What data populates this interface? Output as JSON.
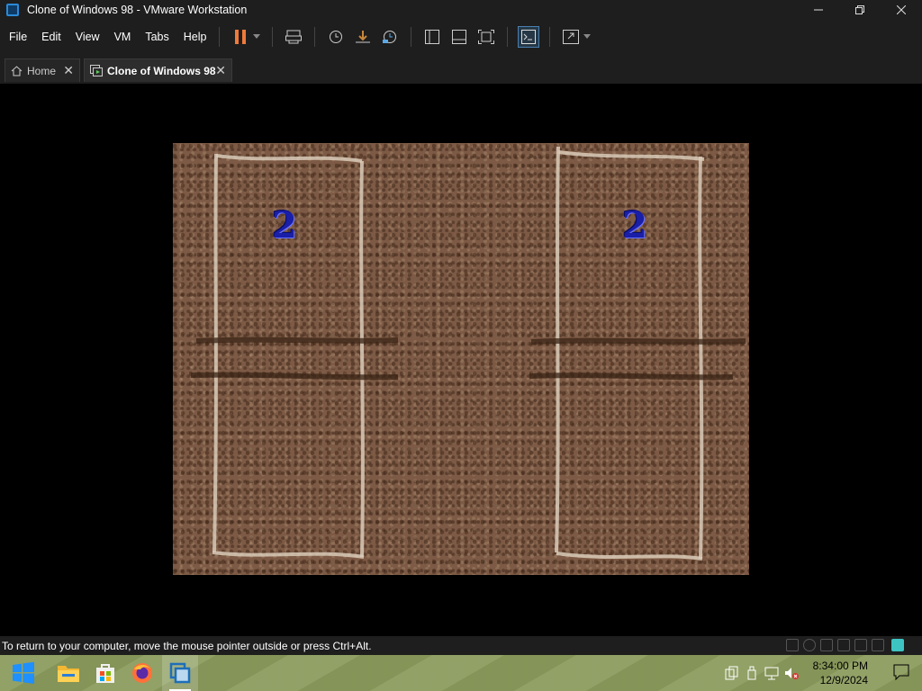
{
  "window": {
    "title": "Clone of Windows 98 - VMware Workstation",
    "controls": [
      "minimize",
      "restore",
      "close"
    ]
  },
  "menu": {
    "items": [
      "File",
      "Edit",
      "View",
      "VM",
      "Tabs",
      "Help"
    ]
  },
  "toolbar": {
    "buttons": [
      "pause-icon",
      "chevron-down-icon",
      "send-keys-icon",
      "snapshot-icon",
      "revert-snapshot-icon",
      "snapshot-manager-icon",
      "library-icon",
      "thumbnail-icon",
      "fullscreen-icon",
      "console-icon",
      "unity-icon",
      "chevron-down-icon"
    ],
    "pause_color": "#f07a3a"
  },
  "tabs": [
    {
      "label": "Home",
      "icon": "home-icon"
    },
    {
      "label": "Clone of Windows 98",
      "icon": "vm-icon",
      "active": true
    }
  ],
  "game": {
    "numbers": [
      "2",
      "2"
    ],
    "number_color": "#1a1fa8"
  },
  "status": {
    "message": "To return to your computer, move the mouse pointer outside or press Ctrl+Alt."
  },
  "taskbar": {
    "apps": [
      "windows-start-icon",
      "file-explorer-icon",
      "store-icon",
      "firefox-icon",
      "vmware-icon"
    ],
    "clock_time": "8:34:00 PM",
    "clock_date": "12/9/2024"
  },
  "colors": {
    "chrome_bg": "#1e1e1e",
    "accent": "#2a8ad8",
    "taskbar_bg": "#8a9a5b",
    "soil": "#7d5a45"
  }
}
